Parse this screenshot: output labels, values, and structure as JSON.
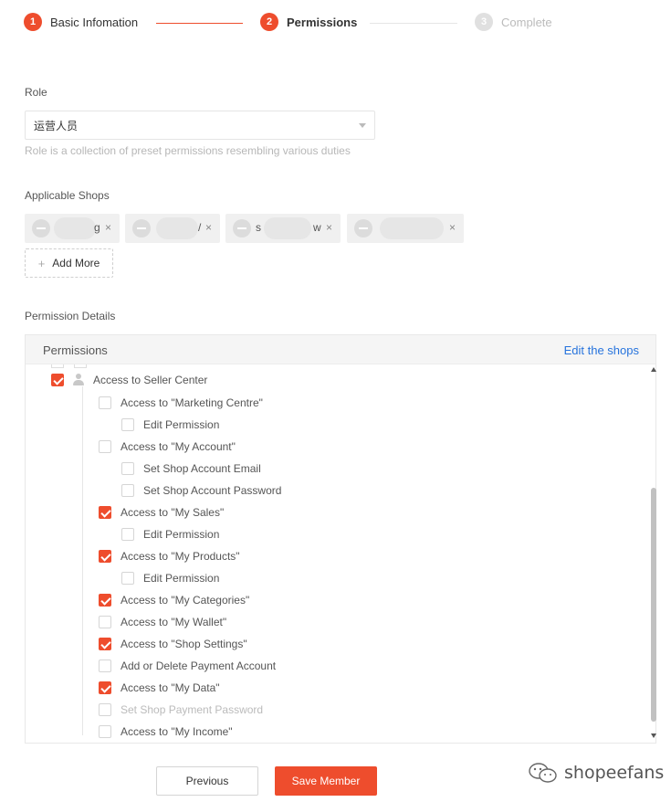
{
  "steps": [
    {
      "num": "1",
      "label": "Basic Infomation",
      "state": "done"
    },
    {
      "num": "2",
      "label": "Permissions",
      "state": "active"
    },
    {
      "num": "3",
      "label": "Complete",
      "state": "todo"
    }
  ],
  "role": {
    "label": "Role",
    "value": "运营人员",
    "hint": "Role is a collection of preset permissions resembling various duties"
  },
  "shops": {
    "label": "Applicable Shops",
    "tags": [
      {
        "fragment": "g",
        "remove": "×"
      },
      {
        "fragment": "/",
        "remove": "×"
      },
      {
        "fragment_left": "s",
        "fragment": "w",
        "remove": "×"
      },
      {
        "fragment": "",
        "remove": "×"
      }
    ],
    "add_more": "Add More",
    "add_icon": "+"
  },
  "permissions": {
    "section_label": "Permission Details",
    "header_title": "Permissions",
    "edit_link": "Edit the shops",
    "root": {
      "label": "Access to Seller Center",
      "checked": true
    },
    "items": [
      {
        "label": "Access to \"Marketing Centre\"",
        "level": 1,
        "checked": false,
        "disabled": false
      },
      {
        "label": "Edit Permission",
        "level": 2,
        "checked": false,
        "disabled": false
      },
      {
        "label": "Access to \"My Account\"",
        "level": 1,
        "checked": false,
        "disabled": false
      },
      {
        "label": "Set Shop Account Email",
        "level": 2,
        "checked": false,
        "disabled": false
      },
      {
        "label": "Set Shop Account Password",
        "level": 2,
        "checked": false,
        "disabled": false
      },
      {
        "label": "Access to \"My Sales\"",
        "level": 1,
        "checked": true,
        "disabled": false
      },
      {
        "label": "Edit Permission",
        "level": 2,
        "checked": false,
        "disabled": false
      },
      {
        "label": "Access to \"My Products\"",
        "level": 1,
        "checked": true,
        "disabled": false
      },
      {
        "label": "Edit Permission",
        "level": 2,
        "checked": false,
        "disabled": false
      },
      {
        "label": "Access to \"My Categories\"",
        "level": 1,
        "checked": true,
        "disabled": false
      },
      {
        "label": "Access to \"My Wallet\"",
        "level": 1,
        "checked": false,
        "disabled": false
      },
      {
        "label": "Access to \"Shop Settings\"",
        "level": 1,
        "checked": true,
        "disabled": false
      },
      {
        "label": "Add or Delete Payment Account",
        "level": 1,
        "checked": false,
        "disabled": false
      },
      {
        "label": "Access to \"My Data\"",
        "level": 1,
        "checked": true,
        "disabled": false
      },
      {
        "label": "Set Shop Payment Password",
        "level": 1,
        "checked": false,
        "disabled": true
      },
      {
        "label": "Access to \"My Income\"",
        "level": 1,
        "checked": false,
        "disabled": false
      }
    ]
  },
  "buttons": {
    "previous": "Previous",
    "save": "Save Member"
  },
  "watermark": {
    "text": "shopeefans",
    "icon": "wechat-icon"
  },
  "colors": {
    "accent": "#ee4d2d",
    "link": "#2673dd"
  }
}
